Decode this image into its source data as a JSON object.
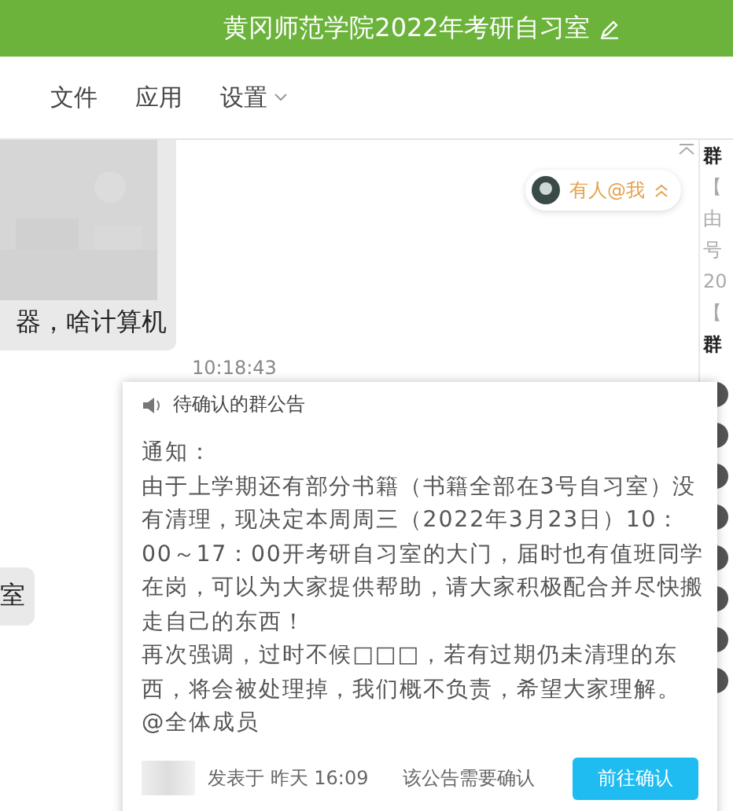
{
  "window": {
    "title": "黄冈师范学院2022年考研自习室"
  },
  "tabs": [
    {
      "label": "文件",
      "selected": false
    },
    {
      "label": "应用",
      "selected": false
    },
    {
      "label": "设置",
      "selected": false
    }
  ],
  "messages": [
    {
      "kind": "image_text",
      "text": "器，啥计算机"
    },
    {
      "kind": "time",
      "text": "10:18:43"
    },
    {
      "kind": "text",
      "text": "室"
    }
  ],
  "mention_pill": {
    "label": "有人@我"
  },
  "sidebar": {
    "items": [
      {
        "text": "群",
        "bold": true
      },
      {
        "text": "【",
        "bold": false
      },
      {
        "text": "由",
        "bold": false
      },
      {
        "text": "号",
        "bold": false
      },
      {
        "text": "20",
        "bold": false
      },
      {
        "text": "【",
        "bold": false
      },
      {
        "text": "群",
        "bold": true
      }
    ]
  },
  "announcement": {
    "title": "待确认的群公告",
    "paragraphs": [
      "通知：",
      "由于上学期还有部分书籍（书籍全部在3号自习室）没有清理，现决定本周周三（2022年3月23日）10：00～17：00开考研自习室的大门，届时也有值班同学在岗，可以为大家提供帮助，请大家积极配合并尽快搬走自己的东西！",
      "再次强调，过时不候□□□，若有过期仍未清理的东西，将会被处理掉，我们概不负责，希望大家理解。",
      "@全体成员"
    ],
    "posted": "发表于 昨天 16:09",
    "note": "该公告需要确认",
    "button": "前往确认"
  }
}
